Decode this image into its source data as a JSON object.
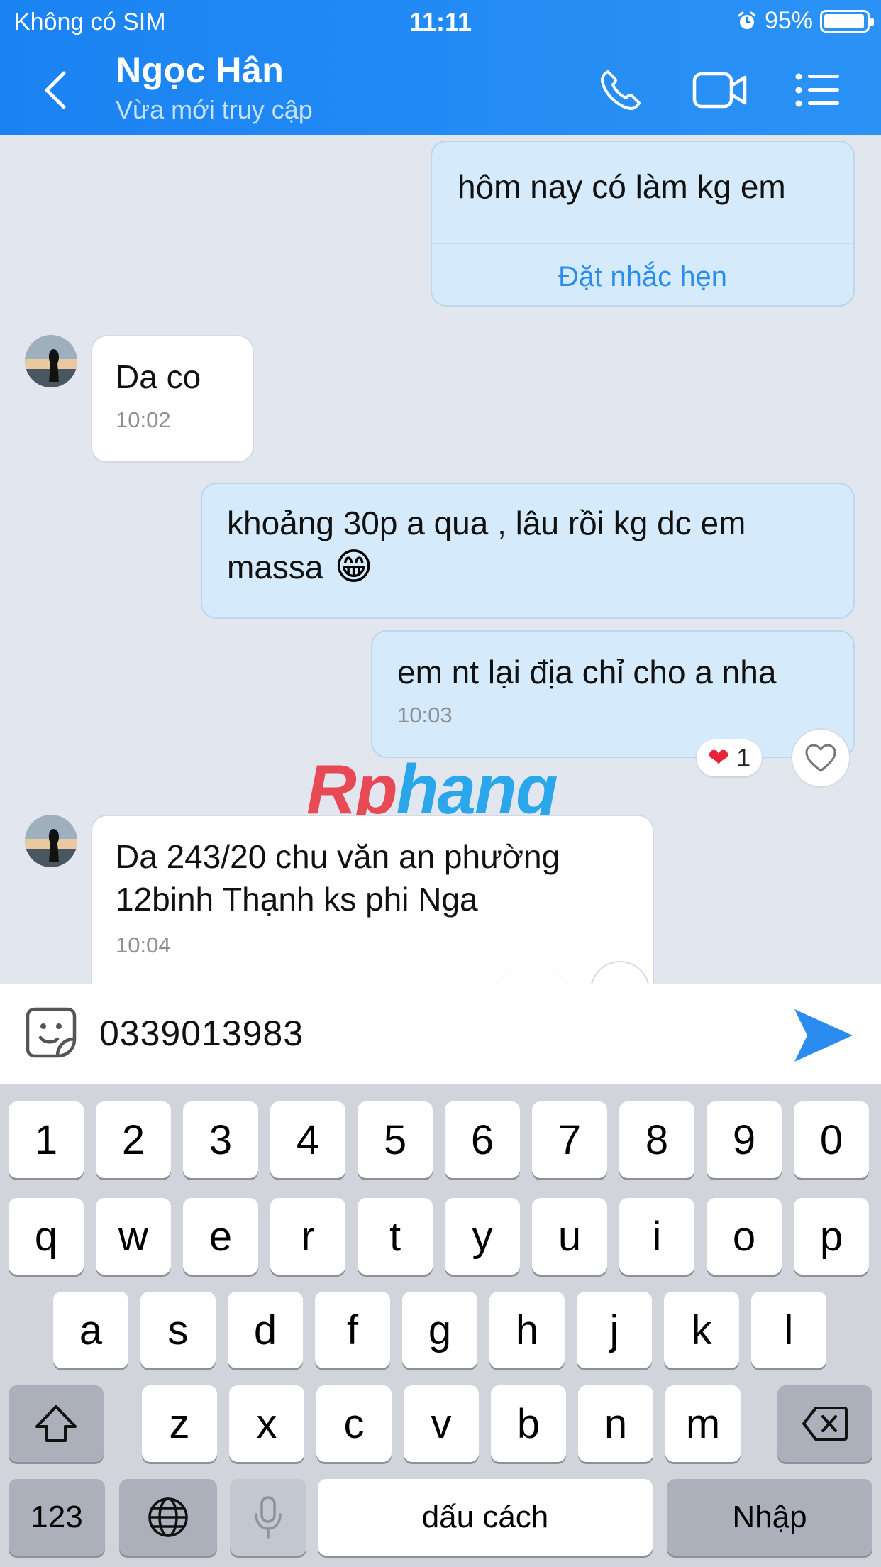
{
  "status_bar": {
    "carrier": "Không có SIM",
    "time": "11:11",
    "battery": "95%",
    "alarm_icon": "alarm-clock-icon"
  },
  "header": {
    "name": "Ngọc Hân",
    "status": "Vừa mới truy cập",
    "icons": [
      "chevron-left-icon",
      "phone-icon",
      "video-camera-icon",
      "menu-icon"
    ]
  },
  "messages": [
    {
      "from": "me",
      "text": "hôm nay có làm kg em",
      "action": "Đặt nhắc hẹn"
    },
    {
      "from": "them",
      "text": "Da co",
      "time": "10:02"
    },
    {
      "from": "me",
      "text_line1": "khoảng 30p a qua , lâu rồi kg dc em",
      "text_line2": "massa",
      "emoji": "😁"
    },
    {
      "from": "me",
      "text": "em nt lại địa chỉ cho a nha",
      "time": "10:03",
      "reaction": {
        "emoji": "❤",
        "count": "1"
      }
    },
    {
      "from": "them",
      "text_line1": "Da 243/20 chu văn an phường",
      "text_line2": "12binh Thạnh ks phi Nga",
      "time": "10:04"
    }
  ],
  "watermark": {
    "part1": "Rp",
    "part2": "hang"
  },
  "input": {
    "value": "0339013983",
    "emoji_icon": "sticker-smile-icon",
    "send_icon": "send-arrow-icon"
  },
  "keyboard": {
    "row1": [
      "1",
      "2",
      "3",
      "4",
      "5",
      "6",
      "7",
      "8",
      "9",
      "0"
    ],
    "row2": [
      "q",
      "w",
      "e",
      "r",
      "t",
      "y",
      "u",
      "i",
      "o",
      "p"
    ],
    "row3": [
      "a",
      "s",
      "d",
      "f",
      "g",
      "h",
      "j",
      "k",
      "l"
    ],
    "row4": [
      "z",
      "x",
      "c",
      "v",
      "b",
      "n",
      "m"
    ],
    "numbers_key": "123",
    "space_key": "dấu cách",
    "return_key": "Nhập",
    "shift_icon": "shift-icon",
    "delete_icon": "backspace-icon",
    "globe_icon": "globe-icon",
    "mic_icon": "microphone-icon"
  },
  "colors": {
    "header": "#1a83f2",
    "sent_bubble": "#d5ebfb",
    "received_bubble": "#ffffff",
    "chat_bg": "#e2e7ef",
    "link": "#2b8cf0",
    "keyboard_bg": "#d1d4da"
  }
}
